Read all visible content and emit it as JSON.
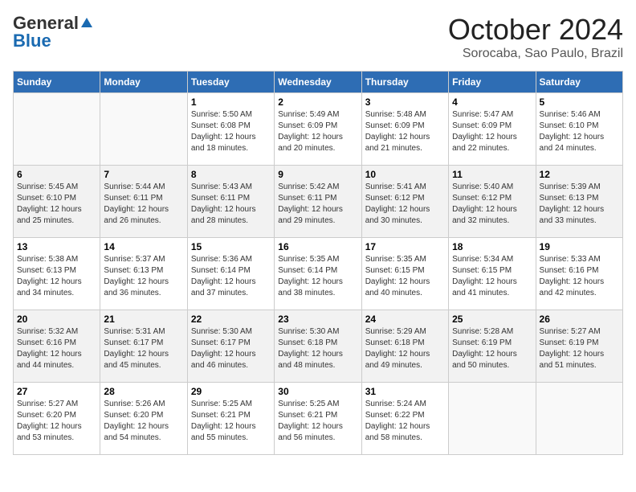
{
  "logo": {
    "general": "General",
    "blue": "Blue"
  },
  "title": "October 2024",
  "location": "Sorocaba, Sao Paulo, Brazil",
  "days_of_week": [
    "Sunday",
    "Monday",
    "Tuesday",
    "Wednesday",
    "Thursday",
    "Friday",
    "Saturday"
  ],
  "weeks": [
    [
      {
        "day": "",
        "info": ""
      },
      {
        "day": "",
        "info": ""
      },
      {
        "day": "1",
        "info": "Sunrise: 5:50 AM\nSunset: 6:08 PM\nDaylight: 12 hours and 18 minutes."
      },
      {
        "day": "2",
        "info": "Sunrise: 5:49 AM\nSunset: 6:09 PM\nDaylight: 12 hours and 20 minutes."
      },
      {
        "day": "3",
        "info": "Sunrise: 5:48 AM\nSunset: 6:09 PM\nDaylight: 12 hours and 21 minutes."
      },
      {
        "day": "4",
        "info": "Sunrise: 5:47 AM\nSunset: 6:09 PM\nDaylight: 12 hours and 22 minutes."
      },
      {
        "day": "5",
        "info": "Sunrise: 5:46 AM\nSunset: 6:10 PM\nDaylight: 12 hours and 24 minutes."
      }
    ],
    [
      {
        "day": "6",
        "info": "Sunrise: 5:45 AM\nSunset: 6:10 PM\nDaylight: 12 hours and 25 minutes."
      },
      {
        "day": "7",
        "info": "Sunrise: 5:44 AM\nSunset: 6:11 PM\nDaylight: 12 hours and 26 minutes."
      },
      {
        "day": "8",
        "info": "Sunrise: 5:43 AM\nSunset: 6:11 PM\nDaylight: 12 hours and 28 minutes."
      },
      {
        "day": "9",
        "info": "Sunrise: 5:42 AM\nSunset: 6:11 PM\nDaylight: 12 hours and 29 minutes."
      },
      {
        "day": "10",
        "info": "Sunrise: 5:41 AM\nSunset: 6:12 PM\nDaylight: 12 hours and 30 minutes."
      },
      {
        "day": "11",
        "info": "Sunrise: 5:40 AM\nSunset: 6:12 PM\nDaylight: 12 hours and 32 minutes."
      },
      {
        "day": "12",
        "info": "Sunrise: 5:39 AM\nSunset: 6:13 PM\nDaylight: 12 hours and 33 minutes."
      }
    ],
    [
      {
        "day": "13",
        "info": "Sunrise: 5:38 AM\nSunset: 6:13 PM\nDaylight: 12 hours and 34 minutes."
      },
      {
        "day": "14",
        "info": "Sunrise: 5:37 AM\nSunset: 6:13 PM\nDaylight: 12 hours and 36 minutes."
      },
      {
        "day": "15",
        "info": "Sunrise: 5:36 AM\nSunset: 6:14 PM\nDaylight: 12 hours and 37 minutes."
      },
      {
        "day": "16",
        "info": "Sunrise: 5:35 AM\nSunset: 6:14 PM\nDaylight: 12 hours and 38 minutes."
      },
      {
        "day": "17",
        "info": "Sunrise: 5:35 AM\nSunset: 6:15 PM\nDaylight: 12 hours and 40 minutes."
      },
      {
        "day": "18",
        "info": "Sunrise: 5:34 AM\nSunset: 6:15 PM\nDaylight: 12 hours and 41 minutes."
      },
      {
        "day": "19",
        "info": "Sunrise: 5:33 AM\nSunset: 6:16 PM\nDaylight: 12 hours and 42 minutes."
      }
    ],
    [
      {
        "day": "20",
        "info": "Sunrise: 5:32 AM\nSunset: 6:16 PM\nDaylight: 12 hours and 44 minutes."
      },
      {
        "day": "21",
        "info": "Sunrise: 5:31 AM\nSunset: 6:17 PM\nDaylight: 12 hours and 45 minutes."
      },
      {
        "day": "22",
        "info": "Sunrise: 5:30 AM\nSunset: 6:17 PM\nDaylight: 12 hours and 46 minutes."
      },
      {
        "day": "23",
        "info": "Sunrise: 5:30 AM\nSunset: 6:18 PM\nDaylight: 12 hours and 48 minutes."
      },
      {
        "day": "24",
        "info": "Sunrise: 5:29 AM\nSunset: 6:18 PM\nDaylight: 12 hours and 49 minutes."
      },
      {
        "day": "25",
        "info": "Sunrise: 5:28 AM\nSunset: 6:19 PM\nDaylight: 12 hours and 50 minutes."
      },
      {
        "day": "26",
        "info": "Sunrise: 5:27 AM\nSunset: 6:19 PM\nDaylight: 12 hours and 51 minutes."
      }
    ],
    [
      {
        "day": "27",
        "info": "Sunrise: 5:27 AM\nSunset: 6:20 PM\nDaylight: 12 hours and 53 minutes."
      },
      {
        "day": "28",
        "info": "Sunrise: 5:26 AM\nSunset: 6:20 PM\nDaylight: 12 hours and 54 minutes."
      },
      {
        "day": "29",
        "info": "Sunrise: 5:25 AM\nSunset: 6:21 PM\nDaylight: 12 hours and 55 minutes."
      },
      {
        "day": "30",
        "info": "Sunrise: 5:25 AM\nSunset: 6:21 PM\nDaylight: 12 hours and 56 minutes."
      },
      {
        "day": "31",
        "info": "Sunrise: 5:24 AM\nSunset: 6:22 PM\nDaylight: 12 hours and 58 minutes."
      },
      {
        "day": "",
        "info": ""
      },
      {
        "day": "",
        "info": ""
      }
    ]
  ]
}
